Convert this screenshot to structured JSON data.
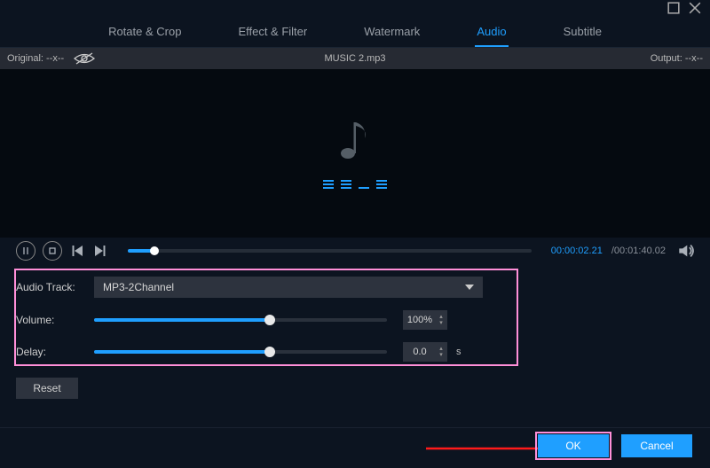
{
  "window": {
    "maximize": "max",
    "close": "close"
  },
  "tabs": {
    "rotate": "Rotate & Crop",
    "effect": "Effect & Filter",
    "watermark": "Watermark",
    "audio": "Audio",
    "subtitle": "Subtitle"
  },
  "filebar": {
    "original_label": "Original:",
    "original_value": "--x--",
    "filename": "MUSIC 2.mp3",
    "output_label": "Output:",
    "output_value": "--x--"
  },
  "playback": {
    "current_time": "00:00:02.21",
    "total_time": "/00:01:40.02"
  },
  "panel": {
    "audio_track_label": "Audio Track:",
    "audio_track_value": "MP3-2Channel",
    "volume_label": "Volume:",
    "volume_value": "100%",
    "delay_label": "Delay:",
    "delay_value": "0.0",
    "delay_unit": "s",
    "reset": "Reset"
  },
  "footer": {
    "ok": "OK",
    "cancel": "Cancel"
  }
}
